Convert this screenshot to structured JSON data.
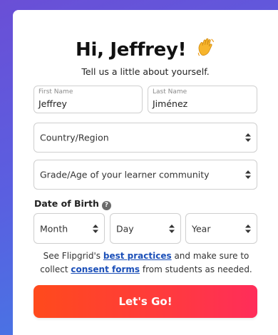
{
  "header": {
    "title": "Hi, Jeffrey!",
    "subtitle": "Tell us a little about yourself."
  },
  "first_name": {
    "label": "First Name",
    "value": "Jeffrey"
  },
  "last_name": {
    "label": "Last Name",
    "value": "Jiménez"
  },
  "country_select": {
    "placeholder": "Country/Region"
  },
  "grade_select": {
    "placeholder": "Grade/Age of your learner community"
  },
  "dob": {
    "label": "Date of Birth",
    "help": "?",
    "month": "Month",
    "day": "Day",
    "year": "Year"
  },
  "info": {
    "prefix": "See Flipgrid's ",
    "best_practices": "best practices",
    "middle": " and make sure to collect ",
    "consent_forms": "consent forms",
    "suffix": " from students as needed."
  },
  "submit": {
    "label": "Let's Go!"
  },
  "colors": {
    "background_top": "#6a4fd6",
    "background_bottom": "#3f7fe6",
    "link": "#1b4fb8",
    "button_start": "#ff4a1c",
    "button_end": "#ff2d5a"
  },
  "icons": {
    "wave": "waving-hand-icon",
    "select": "updown-chevron-icon",
    "help": "question-mark-icon"
  }
}
